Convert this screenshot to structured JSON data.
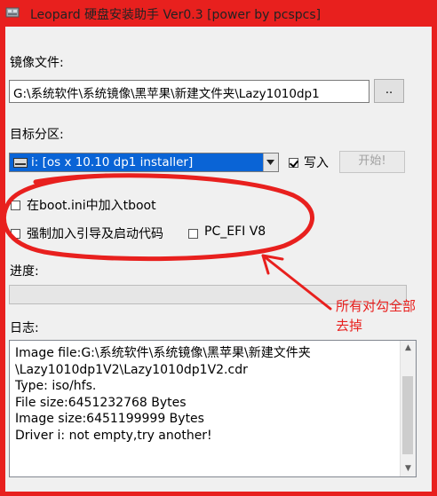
{
  "window": {
    "title": "Leopard 硬盘安装助手 Ver0.3 [power by pcspcs]"
  },
  "image_file": {
    "label": "镜像文件:",
    "value": "G:\\系统软件\\系统镜像\\黑苹果\\新建文件夹\\Lazy1010dp1",
    "browse_label": ".."
  },
  "target": {
    "label": "目标分区:",
    "selected": "i: [os x 10.10 dp1 installer]",
    "write_label": "写入",
    "write_checked": true,
    "start_label": "开始!"
  },
  "options": {
    "boot_ini_label": "在boot.ini中加入tboot",
    "force_boot_label": "强制加入引导及启动代码",
    "pc_efi_label": "PC_EFI V8"
  },
  "progress": {
    "label": "进度:",
    "value": 0
  },
  "log": {
    "label": "日志:",
    "lines": [
      "Image file:G:\\系统软件\\系统镜像\\黑苹果\\新建文件夹",
      "\\Lazy1010dp1V2\\Lazy1010dp1V2.cdr",
      "Type: iso/hfs.",
      "File size:6451232768 Bytes",
      "Image size:6451199999 Bytes",
      "Driver i: not empty,try another!"
    ]
  },
  "annotation": {
    "line1": "所有对勾全部",
    "line2": "去掉",
    "color": "#e8201e"
  },
  "colors": {
    "frame": "#e8201e",
    "select_highlight": "#0a64d6"
  }
}
